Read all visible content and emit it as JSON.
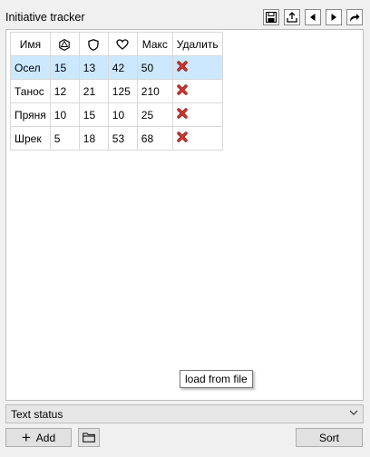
{
  "window": {
    "title": "Initiative tracker"
  },
  "toolbar": {
    "save_icon": "save-icon",
    "export_icon": "export-icon",
    "prev_icon": "triangle-left-icon",
    "next_icon": "triangle-right-icon",
    "redo_icon": "redo-arrow-icon"
  },
  "table": {
    "headers": {
      "name": "Имя",
      "initiative_icon": "d20-icon",
      "armor_icon": "shield-icon",
      "hp_icon": "heart-icon",
      "max": "Макс",
      "delete": "Удалить"
    },
    "rows": [
      {
        "name": "Осел",
        "initiative": "15",
        "armor": "13",
        "hp": "42",
        "max": "50",
        "delete_icon": "red-x-icon",
        "selected": true
      },
      {
        "name": "Танос",
        "initiative": "12",
        "armor": "21",
        "hp": "125",
        "max": "210",
        "delete_icon": "red-x-icon",
        "selected": false
      },
      {
        "name": "Пряня",
        "initiative": "10",
        "armor": "15",
        "hp": "10",
        "max": "25",
        "delete_icon": "red-x-icon",
        "selected": false
      },
      {
        "name": "Шрек",
        "initiative": "5",
        "armor": "18",
        "hp": "53",
        "max": "68",
        "delete_icon": "red-x-icon",
        "selected": false
      }
    ]
  },
  "tooltip": {
    "text": "load from file"
  },
  "status": {
    "text": "Text status"
  },
  "buttons": {
    "add_label": "Add",
    "folder_icon": "folder-icon",
    "sort_label": "Sort"
  },
  "colors": {
    "selected_row": "#cce8ff",
    "delete_x": "#d9342b"
  }
}
